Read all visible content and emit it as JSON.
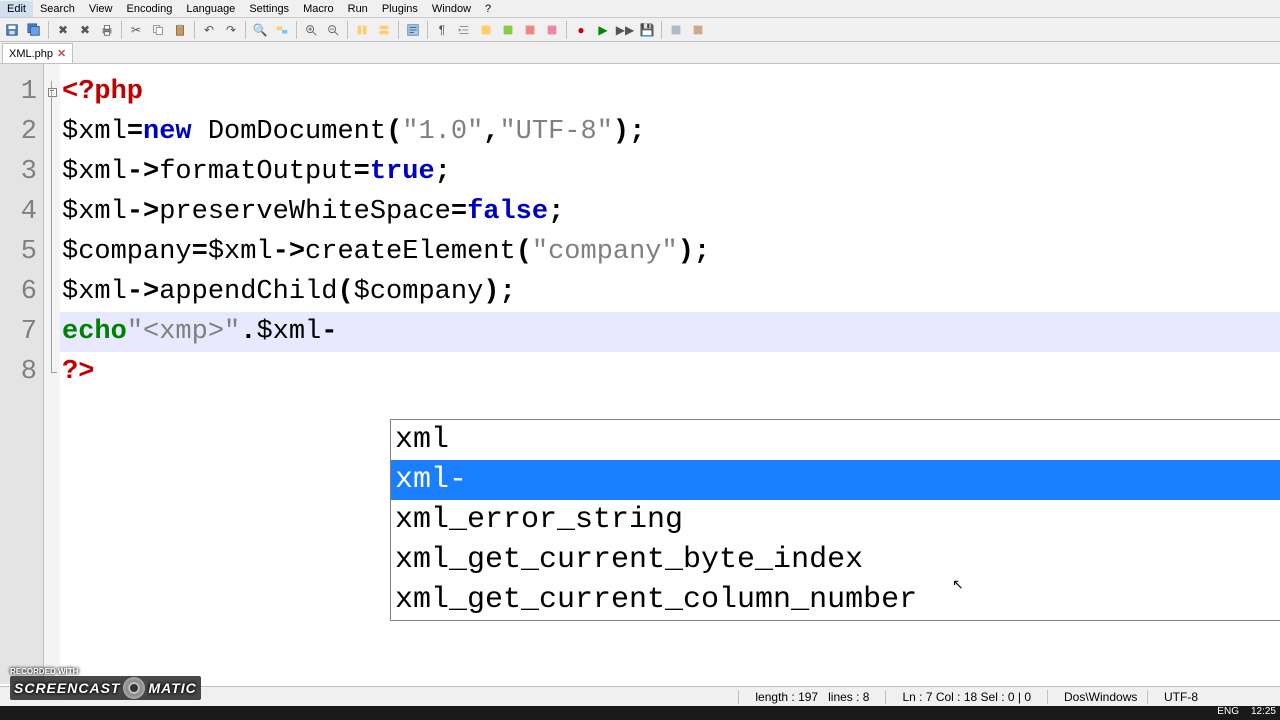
{
  "menu": {
    "items": [
      "Edit",
      "Search",
      "View",
      "Encoding",
      "Language",
      "Settings",
      "Macro",
      "Run",
      "Plugins",
      "Window",
      "?"
    ]
  },
  "tab": {
    "name": "XML.php",
    "close": "✕"
  },
  "gutter": [
    "1",
    "2",
    "3",
    "4",
    "5",
    "6",
    "7",
    "8"
  ],
  "code": {
    "l1": {
      "open": "<?php"
    },
    "l2": {
      "v1": "$xml",
      "eq": "=",
      "kw": "new",
      "sp": " ",
      "cls": "DomDocument",
      "op": "(",
      "s1": "\"1.0\"",
      "cm": ",",
      "s2": "\"UTF-8\"",
      "cl": ")",
      "sc": ";"
    },
    "l3": {
      "v1": "$xml",
      "ar": "->",
      "id": "formatOutput",
      "eq": "=",
      "kw": "true",
      "sc": ";"
    },
    "l4": {
      "v1": "$xml",
      "ar": "->",
      "id": "preserveWhiteSpace",
      "eq": "=",
      "kw": "false",
      "sc": ";"
    },
    "l5": {
      "v1": "$company",
      "eq": "=",
      "v2": "$xml",
      "ar": "->",
      "id": "createElement",
      "op": "(",
      "s1": "\"company\"",
      "cl": ")",
      "sc": ";"
    },
    "l6": {
      "v1": "$xml",
      "ar": "->",
      "id": "appendChild",
      "op": "(",
      "v2": "$company",
      "cl": ")",
      "sc": ";"
    },
    "l7": {
      "kw": "echo",
      "s1": "\"<xmp>\"",
      "dot": ".",
      "v1": "$xml",
      "dash": "-"
    },
    "l8": {
      "close": "?>"
    }
  },
  "autocomplete": {
    "items": [
      "xml",
      "xml-",
      "xml_error_string",
      "xml_get_current_byte_index",
      "xml_get_current_column_number"
    ],
    "selected": 1
  },
  "status": {
    "length": "length : 197",
    "lines": "lines : 8",
    "pos": "Ln : 7   Col : 18   Sel : 0 | 0",
    "eol": "Dos\\Windows",
    "enc": "UTF-8"
  },
  "tray": {
    "lang": "ENG",
    "time": "12:25"
  },
  "watermark": {
    "rec": "RECORDED WITH",
    "brand1": "SCREENCAST",
    "brand2": "MATIC"
  }
}
